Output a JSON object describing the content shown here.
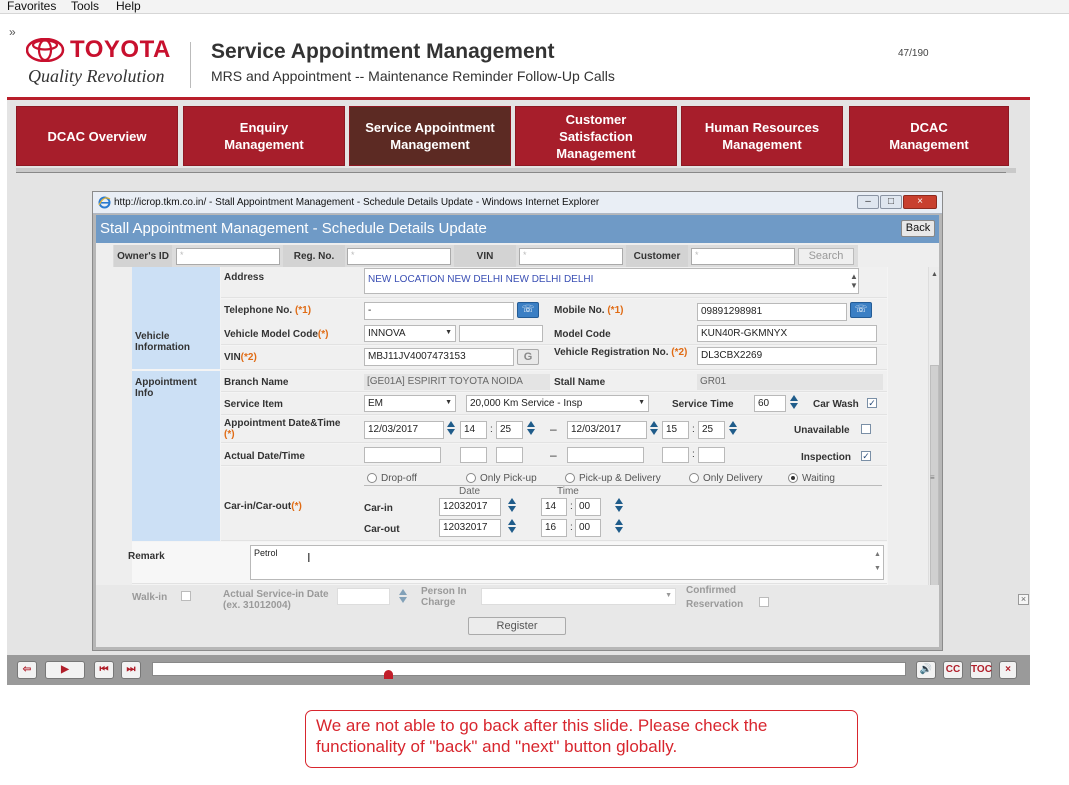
{
  "menubar": {
    "favorites": "Favorites",
    "tools": "Tools",
    "help": "Help"
  },
  "header": {
    "brand": "TOYOTA",
    "tagline": "Quality Revolution",
    "title": "Service Appointment Management",
    "subtitle": "MRS and Appointment -- Maintenance Reminder Follow-Up Calls",
    "page_count": "47/190"
  },
  "nav": [
    {
      "label": "DCAC Overview"
    },
    {
      "label": "Enquiry Management"
    },
    {
      "label": "Service Appointment Management"
    },
    {
      "label": "Customer Satisfaction Management"
    },
    {
      "label": "Human Resources Management"
    },
    {
      "label": "DCAC Management"
    }
  ],
  "ie": {
    "title": "http://icrop.tkm.co.in/ - Stall Appointment Management - Schedule Details Update - Windows Internet Explorer",
    "app_title": "Stall Appointment Management - Schedule Details Update",
    "back": "Back"
  },
  "search": {
    "owner_id": "Owner's ID",
    "reg_no": "Reg. No.",
    "vin": "VIN",
    "customer": "Customer",
    "search_btn": "Search",
    "mark": "*"
  },
  "form": {
    "address_label": "Address",
    "address_value": "NEW LOCATION NEW DELHI NEW DELHI DELHI",
    "telephone_label": "Telephone No.",
    "telephone_req": "(*1)",
    "telephone_value": "-",
    "mobile_label": "Mobile No.",
    "mobile_req": "(*1)",
    "mobile_value": "09891298981",
    "vehicle_section": "Vehicle Information",
    "model_code_label": "Vehicle Model Code",
    "model_code_req": "(*)",
    "model_code_value": "INNOVA",
    "model_code_r_label": "Model Code",
    "model_code_r_value": "KUN40R-GKMNYX",
    "vin_label": "VIN",
    "vin_req": "(*2)",
    "vin_value": "MBJ11JV4007473153",
    "vehicle_reg_label": "Vehicle Registration No.",
    "vehicle_reg_req": "(*2)",
    "vehicle_reg_value": "DL3CBX2269",
    "appt_section": "Appointment Info",
    "branch_label": "Branch Name",
    "branch_value": "[GE01A] ESPIRIT TOYOTA NOIDA",
    "stall_label": "Stall Name",
    "stall_value": "GR01",
    "service_item_label": "Service Item",
    "service_item_value": "EM",
    "service_item_desc": "20,000 Km Service - Insp",
    "service_time_label": "Service Time",
    "service_time_value": "60",
    "car_wash_label": "Car Wash",
    "appt_dt_label": "Appointment Date&Time",
    "appt_dt_req": "(*)",
    "appt_from_date": "12/03/2017",
    "appt_from_h": "14",
    "appt_from_m": "25",
    "dash": "–",
    "appt_to_date": "12/03/2017",
    "appt_to_h": "15",
    "appt_to_m": "25",
    "unavailable_label": "Unavailable",
    "actual_dt_label": "Actual Date/Time",
    "inspection_label": "Inspection",
    "colon": ":",
    "carin_out_label": "Car-in/Car-out",
    "carin_out_req": "(*)",
    "radio_options": [
      "Drop-off",
      "Only Pick-up",
      "Pick-up & Delivery",
      "Only Delivery",
      "Waiting"
    ],
    "col_date": "Date",
    "col_time": "Time",
    "carin_label": "Car-in",
    "carin_date": "12032017",
    "carin_h": "14",
    "carin_m": "00",
    "carout_label": "Car-out",
    "carout_date": "12032017",
    "carout_h": "16",
    "carout_m": "00",
    "remark_label": "Remark",
    "remark_value": "Petrol",
    "walkin_label": "Walk-in",
    "actual_service_label": "Actual Service-in Date (ex. 31012004)",
    "person_label": "Person In Charge",
    "confirmed_label": "Confirmed Reservation",
    "register_btn": "Register"
  },
  "player": {
    "cc": "CC",
    "toc": "TOC",
    "close": "×"
  },
  "note": "We are not able to go back after this slide. Please check the functionality of \"back\" and \"next\" button globally."
}
